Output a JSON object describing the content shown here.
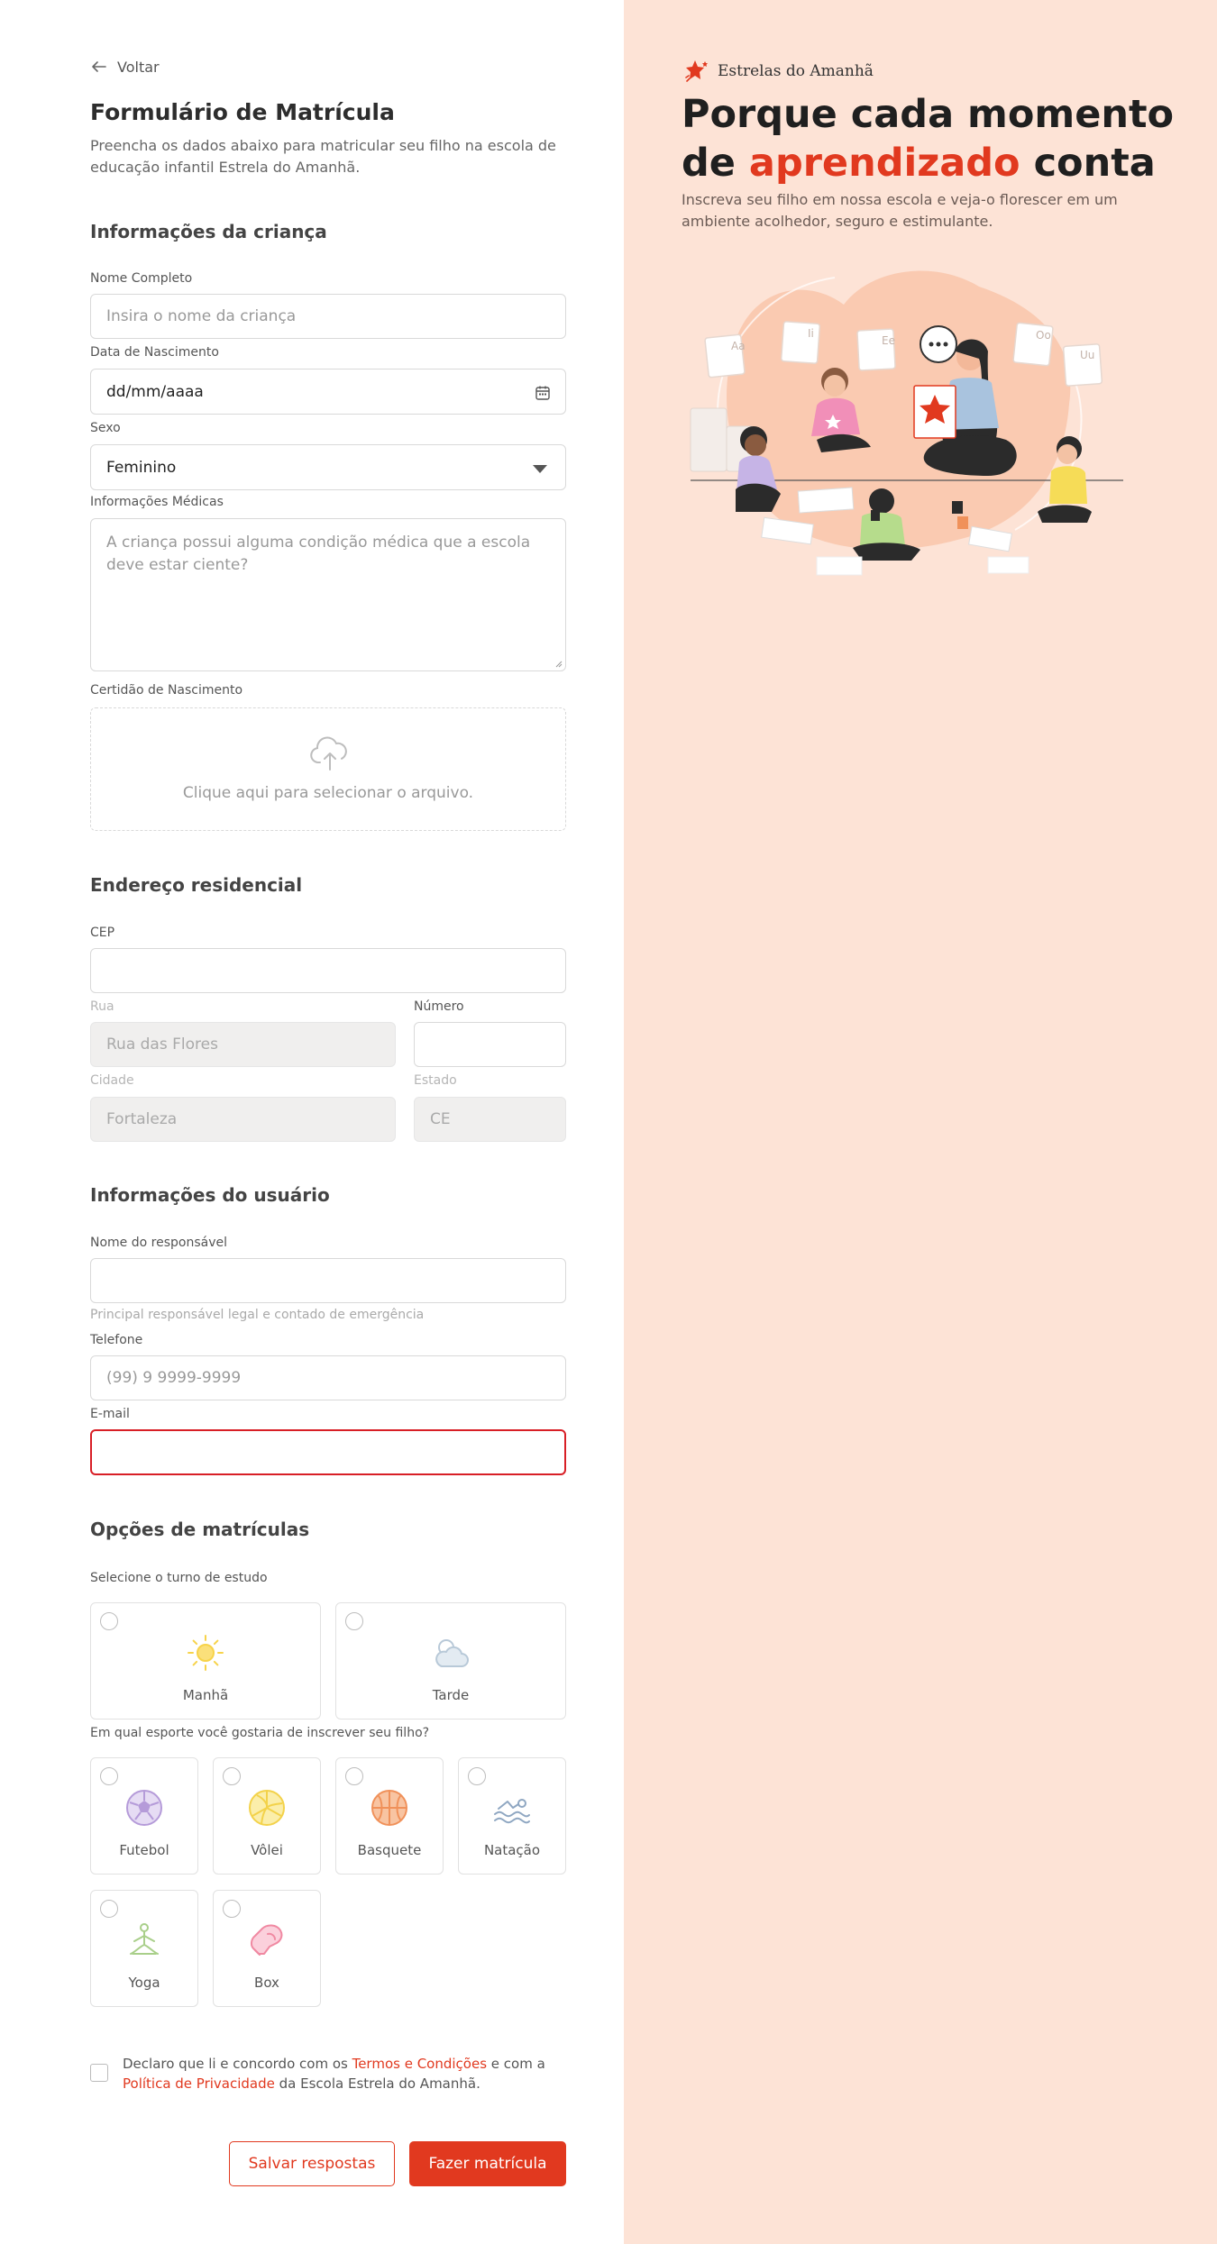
{
  "back_label": "Voltar",
  "form": {
    "title": "Formulário de Matrícula",
    "intro": "Preencha os dados abaixo para matricular seu filho na escola de educação infantil Estrela do Amanhã."
  },
  "child": {
    "section_title": "Informações da criança",
    "name_label": "Nome Completo",
    "name_placeholder": "Insira o nome da criança",
    "birth_label": "Data de Nascimento",
    "birth_value": "dd/mm/aaaa",
    "sex_label": "Sexo",
    "sex_value": "Feminino",
    "medical_label": "Informações Médicas",
    "medical_placeholder": "A criança possui alguma condição médica que a escola deve estar ciente?",
    "certificate_label": "Certidão de Nascimento",
    "upload_text": "Clique aqui para selecionar o arquivo."
  },
  "address": {
    "section_title": "Endereço residencial",
    "cep_label": "CEP",
    "cep_value": "",
    "street_label": "Rua",
    "street_value": "Rua das Flores",
    "number_label": "Número",
    "number_value": "",
    "city_label": "Cidade",
    "city_value": "Fortaleza",
    "state_label": "Estado",
    "state_value": "CE"
  },
  "user": {
    "section_title": "Informações do usuário",
    "guardian_label": "Nome do responsável",
    "guardian_value": "",
    "guardian_help": "Principal responsável legal e contado de emergência",
    "phone_label": "Telefone",
    "phone_placeholder": "(99) 9 9999-9999",
    "email_label": "E-mail",
    "email_value": ""
  },
  "enrollment": {
    "section_title": "Opções de matrículas",
    "shift_question": "Selecione o turno de estudo",
    "shifts": [
      {
        "label": "Manhã",
        "icon": "sun-icon",
        "color": "#f7d34a"
      },
      {
        "label": "Tarde",
        "icon": "cloud-sun-icon",
        "color": "#b8c9d8"
      }
    ],
    "sport_question": "Em qual esporte você gostaria de inscrever seu filho?",
    "sports": [
      {
        "label": "Futebol",
        "icon": "soccer-ball-icon",
        "color": "#b59bd9"
      },
      {
        "label": "Vôlei",
        "icon": "volleyball-icon",
        "color": "#f3d24a"
      },
      {
        "label": "Basquete",
        "icon": "basketball-icon",
        "color": "#f0915a"
      },
      {
        "label": "Natação",
        "icon": "swimmer-icon",
        "color": "#8fa7c2"
      },
      {
        "label": "Yoga",
        "icon": "yoga-icon",
        "color": "#a9cf8a"
      },
      {
        "label": "Box",
        "icon": "boxing-glove-icon",
        "color": "#f089a2"
      }
    ]
  },
  "terms": {
    "pre": "Declaro que li e concordo com os ",
    "terms_link": "Termos e Condições",
    "mid": " e com a ",
    "privacy_link": "Política de Privacidade",
    "post": " da Escola Estrela do Amanhã."
  },
  "buttons": {
    "save": "Salvar respostas",
    "submit": "Fazer matrícula"
  },
  "brand": {
    "name": "Estrelas do Amanhã",
    "headline_1": "Porque cada momento",
    "headline_2a": "de ",
    "headline_accent": "aprendizado",
    "headline_2b": " conta",
    "subtext": "Inscreva seu filho em nossa escola e veja-o florescer em um ambiente acolhedor, seguro e estimulante."
  },
  "colors": {
    "accent": "#e1391f",
    "panel_bg": "#fde3d6",
    "error": "#d81f26"
  }
}
